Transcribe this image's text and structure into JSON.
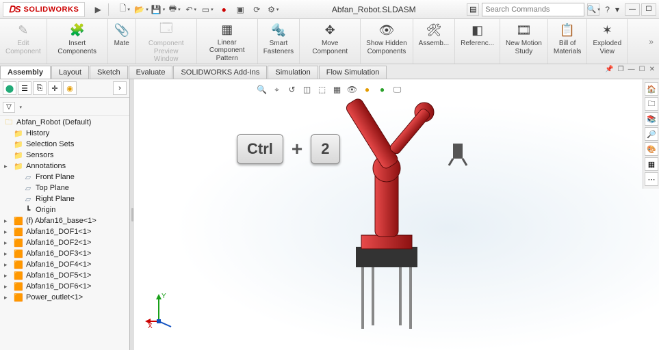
{
  "app": {
    "logo_text": "SOLIDWORKS",
    "filename": "Abfan_Robot.SLDASM",
    "search_placeholder": "Search Commands",
    "help_symbol": "?"
  },
  "qat_icons": [
    "new",
    "open",
    "save",
    "print",
    "undo",
    "select",
    "rec",
    "stop",
    "options",
    "settings"
  ],
  "ribbon": [
    {
      "key": "edit_component",
      "label": "Edit\nComponent",
      "disabled": true
    },
    {
      "key": "insert_components",
      "label": "Insert Components"
    },
    {
      "key": "mate",
      "label": "Mate"
    },
    {
      "key": "component_preview",
      "label": "Component\nPreview Window",
      "disabled": true
    },
    {
      "key": "linear_pattern",
      "label": "Linear Component Pattern"
    },
    {
      "key": "smart_fasteners",
      "label": "Smart\nFasteners"
    },
    {
      "key": "move_component",
      "label": "Move Component"
    },
    {
      "key": "show_hidden",
      "label": "Show Hidden\nComponents"
    },
    {
      "key": "assembly_features",
      "label": "Assemb..."
    },
    {
      "key": "reference_geometry",
      "label": "Referenc..."
    },
    {
      "key": "new_motion_study",
      "label": "New Motion\nStudy"
    },
    {
      "key": "bom",
      "label": "Bill of\nMaterials"
    },
    {
      "key": "exploded_view",
      "label": "Exploded\nView"
    }
  ],
  "tabs": {
    "items": [
      "Assembly",
      "Layout",
      "Sketch",
      "Evaluate",
      "SOLIDWORKS Add-Ins",
      "Simulation",
      "Flow Simulation"
    ],
    "active": "Assembly"
  },
  "tree": {
    "root": "Abfan_Robot  (Default)",
    "nodes": [
      {
        "icon": "fold",
        "label": "History"
      },
      {
        "icon": "fold",
        "label": "Selection Sets"
      },
      {
        "icon": "fold",
        "label": "Sensors"
      },
      {
        "icon": "fold",
        "label": "Annotations",
        "expandable": true
      },
      {
        "icon": "plane",
        "label": "Front Plane",
        "indent": true
      },
      {
        "icon": "plane",
        "label": "Top Plane",
        "indent": true
      },
      {
        "icon": "plane",
        "label": "Right Plane",
        "indent": true
      },
      {
        "icon": "origin",
        "label": "Origin",
        "indent": true
      },
      {
        "icon": "part",
        "label": "(f) Abfan16_base<1>",
        "expandable": true
      },
      {
        "icon": "part",
        "label": "Abfan16_DOF1<1>",
        "expandable": true
      },
      {
        "icon": "part",
        "label": "Abfan16_DOF2<1>",
        "expandable": true
      },
      {
        "icon": "part",
        "label": "Abfan16_DOF3<1>",
        "expandable": true
      },
      {
        "icon": "part",
        "label": "Abfan16_DOF4<1>",
        "expandable": true
      },
      {
        "icon": "part",
        "label": "Abfan16_DOF5<1>",
        "expandable": true
      },
      {
        "icon": "part",
        "label": "Abfan16_DOF6<1>",
        "expandable": true
      },
      {
        "icon": "part",
        "label": "Power_outlet<1>",
        "expandable": true
      }
    ]
  },
  "overlay": {
    "key1": "Ctrl",
    "plus": "+",
    "key2": "2"
  },
  "triad": {
    "x": "X",
    "y": "Y"
  },
  "colors": {
    "brand": "#cc0000",
    "robot": "#c32121",
    "robot_dark": "#7d1111"
  }
}
